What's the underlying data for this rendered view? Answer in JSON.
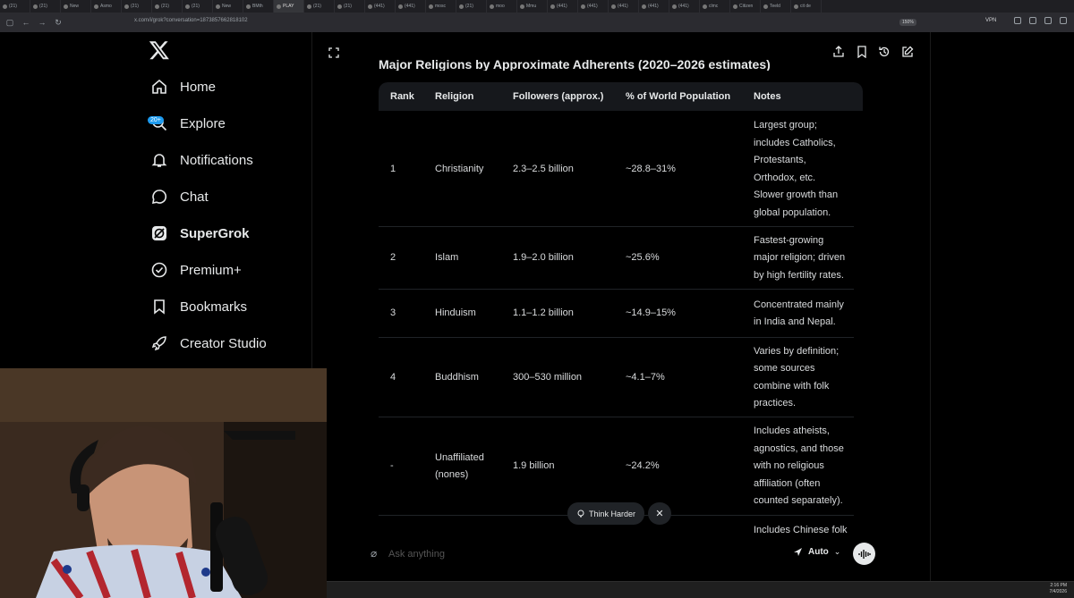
{
  "browser": {
    "tabs": [
      "(21)",
      "(21)",
      "New",
      "Asmo",
      "(21)",
      "(21)",
      "(21)",
      "New",
      "BMth",
      "PLAY",
      "(21)",
      "(21)",
      "(441)",
      "(441)",
      "mosc",
      "(21)",
      "moo",
      "Mmu",
      "(441)",
      "(441)",
      "(441)",
      "(441)",
      "(441)",
      "clmc",
      "Citizen",
      "Teeld",
      "cit de"
    ],
    "url": "x.com/i/grok?conversation=1873857662818102",
    "zoom": "150%",
    "vpn_label": "VPN"
  },
  "sidebar": {
    "items": [
      {
        "label": "Home",
        "icon": "home-icon"
      },
      {
        "label": "Explore",
        "icon": "search-icon"
      },
      {
        "label": "Notifications",
        "icon": "bell-icon"
      },
      {
        "label": "Chat",
        "icon": "chat-bubble-icon"
      },
      {
        "label": "SuperGrok",
        "icon": "grok-icon"
      },
      {
        "label": "Premium+",
        "icon": "verified-icon"
      },
      {
        "label": "Bookmarks",
        "icon": "bookmark-icon"
      },
      {
        "label": "Creator Studio",
        "icon": "rocket-icon"
      }
    ],
    "notification_badge": "20+"
  },
  "main": {
    "table_title": "Major Religions by Approximate Adherents (2020–2026 estimates)",
    "table": {
      "headers": [
        "Rank",
        "Religion",
        "Followers (approx.)",
        "% of World Population",
        "Notes"
      ],
      "rows": [
        {
          "rank": "1",
          "religion": "Christianity",
          "followers": "2.3–2.5 billion",
          "pct": "~28.8–31%",
          "notes": [
            "Largest group;",
            "includes Catholics,",
            "Protestants,",
            "Orthodox, etc.",
            "Slower growth than",
            "global population."
          ]
        },
        {
          "rank": "2",
          "religion": "Islam",
          "followers": "1.9–2.0 billion",
          "pct": "~25.6%",
          "notes": [
            "Fastest-growing",
            "major religion; driven",
            "by high fertility rates."
          ]
        },
        {
          "rank": "3",
          "religion": "Hinduism",
          "followers": "1.1–1.2 billion",
          "pct": "~14.9–15%",
          "notes": [
            "Concentrated mainly",
            "in India and Nepal."
          ]
        },
        {
          "rank": "4",
          "religion": "Buddhism",
          "followers": "300–530 million",
          "pct": "~4.1–7%",
          "notes": [
            "Varies by definition;",
            "some sources",
            "combine with folk",
            "practices."
          ]
        },
        {
          "rank": "-",
          "religion": [
            "Unaffiliated",
            "(nones)"
          ],
          "followers": "1.9 billion",
          "pct": "~24.2%",
          "notes": [
            "Includes atheists,",
            "agnostics, and those",
            "with no religious",
            "affiliation (often",
            "counted separately)."
          ]
        },
        {
          "rank": "",
          "religion": "",
          "followers": "",
          "pct": "",
          "notes": [
            "Includes Chinese folk"
          ]
        }
      ]
    },
    "think_harder_label": "Think Harder",
    "composer": {
      "placeholder": "Ask anything",
      "mode_label": "Auto"
    }
  },
  "taskbar": {
    "time": "2:16 PM",
    "date": "7/4/2026"
  },
  "colors": {
    "background": "#000000",
    "table_header_bg": "#16181c",
    "badge": "#1d9bf0",
    "text": "#e7e9ea"
  }
}
